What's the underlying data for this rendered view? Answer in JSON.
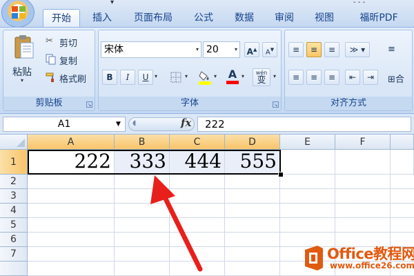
{
  "title_bar": {
    "qat_tail_glyph": "▾",
    "corner_text": "- - -"
  },
  "tabs": [
    {
      "label": "开始",
      "active": true
    },
    {
      "label": "插入"
    },
    {
      "label": "页面布局"
    },
    {
      "label": "公式"
    },
    {
      "label": "数据"
    },
    {
      "label": "审阅"
    },
    {
      "label": "视图"
    },
    {
      "label": "福昕PDF"
    }
  ],
  "ribbon": {
    "clipboard": {
      "label": "剪贴板",
      "paste": "粘贴",
      "cut": "剪切",
      "copy": "复制",
      "format_painter": "格式刷"
    },
    "font": {
      "label": "字体",
      "font_name": "宋体",
      "font_size": "20",
      "grow": "A",
      "shrink": "A",
      "bold": "B",
      "italic": "I",
      "underline": "U",
      "color_font": "A",
      "phonetic": "wén",
      "phonetic_char": "变",
      "fill_color": "#ffff00",
      "font_color": "#ff0000"
    },
    "alignment": {
      "label": "对齐方式",
      "wrap_glyph": "≡",
      "merge_label": "合"
    }
  },
  "formula_bar": {
    "name_box": "A1",
    "fx": "fx",
    "value": "222"
  },
  "grid": {
    "columns": [
      "A",
      "B",
      "C",
      "D",
      "E",
      "F"
    ],
    "selected_columns": [
      "A",
      "B",
      "C",
      "D"
    ],
    "rows": [
      "1",
      "2",
      "3",
      "4",
      "5",
      "6",
      "7"
    ],
    "row1_values": [
      "222",
      "333",
      "444",
      "555"
    ]
  },
  "watermark": {
    "title": "Office教程网",
    "url": "www.office26.com"
  },
  "colors": {
    "accent_arrow": "#e8201c",
    "watermark": "#e05a10"
  }
}
